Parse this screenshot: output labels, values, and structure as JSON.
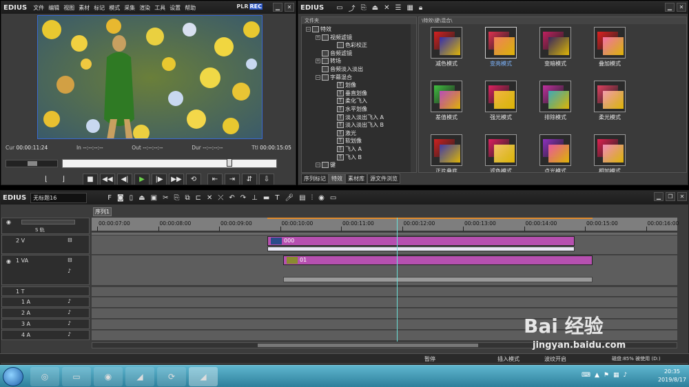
{
  "player": {
    "logo": "EDIUS",
    "menu": [
      "文件",
      "编辑",
      "视图",
      "素材",
      "标记",
      "模式",
      "采集",
      "渲染",
      "工具",
      "设置",
      "帮助"
    ],
    "plr": "PLR",
    "rec": "REC",
    "cur_label": "Cur",
    "cur_value": "00:00:11:24",
    "in_label": "In",
    "in_value": "--:--:--:--",
    "out_label": "Out",
    "out_value": "--:--:--:--",
    "dur_label": "Dur",
    "dur_value": "--:--:--:--",
    "ttl_label": "Ttl",
    "ttl_value": "00:00:15:05"
  },
  "effects": {
    "logo": "EDIUS",
    "tree_header": "文件夹",
    "grid_header": "\\特效\\键\\混合\\",
    "tree": [
      {
        "label": "特效",
        "level": 0,
        "pm": "−"
      },
      {
        "label": "视频滤镜",
        "level": 1,
        "pm": "+"
      },
      {
        "label": "色彩校正",
        "level": 2,
        "pm": ""
      },
      {
        "label": "音频滤镜",
        "level": 1,
        "pm": ""
      },
      {
        "label": "转场",
        "level": 1,
        "pm": "+"
      },
      {
        "label": "音频淡入淡出",
        "level": 1,
        "pm": ""
      },
      {
        "label": "字幕混合",
        "level": 1,
        "pm": "−"
      },
      {
        "label": "划像",
        "level": 2,
        "pm": ""
      },
      {
        "label": "垂直划像",
        "level": 2,
        "pm": ""
      },
      {
        "label": "柔化飞入",
        "level": 2,
        "pm": ""
      },
      {
        "label": "水平划像",
        "level": 2,
        "pm": ""
      },
      {
        "label": "淡入淡出飞入 A",
        "level": 2,
        "pm": ""
      },
      {
        "label": "淡入淡出飞入 B",
        "level": 2,
        "pm": ""
      },
      {
        "label": "激光",
        "level": 2,
        "pm": ""
      },
      {
        "label": "软划像",
        "level": 2,
        "pm": ""
      },
      {
        "label": "飞入 A",
        "level": 2,
        "pm": ""
      },
      {
        "label": "飞入 B",
        "level": 2,
        "pm": ""
      },
      {
        "label": "键",
        "level": 1,
        "pm": "−"
      }
    ],
    "grid": [
      "减色模式",
      "变亮模式",
      "变暗模式",
      "叠加模式",
      "差值模式",
      "强光模式",
      "排除模式",
      "柔光模式",
      "正片叠底",
      "滤色模式",
      "点光模式",
      "相加模式"
    ],
    "bottom_tabs": [
      "序列标记",
      "特效",
      "素材库",
      "源文件浏览"
    ]
  },
  "timeline": {
    "logo": "EDIUS",
    "project_name": "无标题16",
    "sequence_tab": "序列1",
    "ruler": [
      "00:00:07:00",
      "00:00:08:00",
      "00:00:09:00",
      "00:00:10:00",
      "00:00:11:00",
      "00:00:12:00",
      "00:00:13:00",
      "00:00:14:00",
      "00:00:15:00",
      "00:00:16:00"
    ],
    "tracks": {
      "v2": "2 V",
      "va1": "1 VA",
      "t1": "1 T",
      "a1": "1 A",
      "a2": "2 A",
      "a3": "3 A",
      "a4": "4 A",
      "s": "S",
      "vol": "S 轨"
    },
    "clips": {
      "v2": "000",
      "va1": "01"
    }
  },
  "status": {
    "pause": "暂停",
    "insert": "插入模式",
    "ripple": "波纹开启",
    "disk": "磁盘:85% 被使用 (D:)"
  },
  "taskbar": {
    "time": "20:35",
    "date": "2019/8/17"
  },
  "watermark": {
    "brand": "Bai 经验",
    "url": "jingyan.baidu.com"
  },
  "colors": {
    "clip": "#b650b0",
    "rec": "#2a57c9",
    "playhead": "#6bdfd8",
    "selected_label": "#7fb6ff"
  }
}
